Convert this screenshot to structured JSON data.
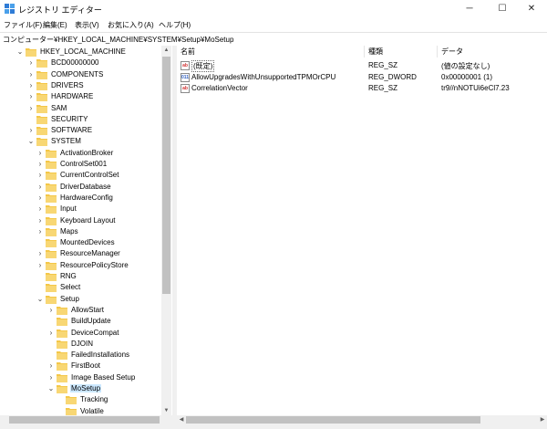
{
  "window": {
    "title": "レジストリ エディター",
    "controls": {
      "minimize": "─",
      "maximize": "☐",
      "close": "✕"
    }
  },
  "menu": [
    "ファイル(F)",
    "編集(E)",
    "表示(V)",
    "お気に入り(A)",
    "ヘルプ(H)"
  ],
  "address": "コンピューター¥HKEY_LOCAL_MACHINE¥SYSTEM¥Setup¥MoSetup",
  "tree": [
    {
      "label": "HKEY_LOCAL_MACHINE",
      "level": 0,
      "chevron": "v",
      "selected": false
    },
    {
      "label": "BCD00000000",
      "level": 1,
      "chevron": ">",
      "selected": false
    },
    {
      "label": "COMPONENTS",
      "level": 1,
      "chevron": ">",
      "selected": false
    },
    {
      "label": "DRIVERS",
      "level": 1,
      "chevron": ">",
      "selected": false
    },
    {
      "label": "HARDWARE",
      "level": 1,
      "chevron": ">",
      "selected": false
    },
    {
      "label": "SAM",
      "level": 1,
      "chevron": ">",
      "selected": false
    },
    {
      "label": "SECURITY",
      "level": 1,
      "chevron": "",
      "selected": false
    },
    {
      "label": "SOFTWARE",
      "level": 1,
      "chevron": ">",
      "selected": false
    },
    {
      "label": "SYSTEM",
      "level": 1,
      "chevron": "v",
      "selected": false
    },
    {
      "label": "ActivationBroker",
      "level": 2,
      "chevron": ">",
      "selected": false
    },
    {
      "label": "ControlSet001",
      "level": 2,
      "chevron": ">",
      "selected": false
    },
    {
      "label": "CurrentControlSet",
      "level": 2,
      "chevron": ">",
      "selected": false
    },
    {
      "label": "DriverDatabase",
      "level": 2,
      "chevron": ">",
      "selected": false
    },
    {
      "label": "HardwareConfig",
      "level": 2,
      "chevron": ">",
      "selected": false
    },
    {
      "label": "Input",
      "level": 2,
      "chevron": ">",
      "selected": false
    },
    {
      "label": "Keyboard Layout",
      "level": 2,
      "chevron": ">",
      "selected": false
    },
    {
      "label": "Maps",
      "level": 2,
      "chevron": ">",
      "selected": false
    },
    {
      "label": "MountedDevices",
      "level": 2,
      "chevron": "",
      "selected": false
    },
    {
      "label": "ResourceManager",
      "level": 2,
      "chevron": ">",
      "selected": false
    },
    {
      "label": "ResourcePolicyStore",
      "level": 2,
      "chevron": ">",
      "selected": false
    },
    {
      "label": "RNG",
      "level": 2,
      "chevron": "",
      "selected": false
    },
    {
      "label": "Select",
      "level": 2,
      "chevron": "",
      "selected": false
    },
    {
      "label": "Setup",
      "level": 2,
      "chevron": "v",
      "selected": false
    },
    {
      "label": "AllowStart",
      "level": 3,
      "chevron": ">",
      "selected": false
    },
    {
      "label": "BuildUpdate",
      "level": 3,
      "chevron": "",
      "selected": false
    },
    {
      "label": "DeviceCompat",
      "level": 3,
      "chevron": ">",
      "selected": false
    },
    {
      "label": "DJOIN",
      "level": 3,
      "chevron": "",
      "selected": false
    },
    {
      "label": "FailedInstallations",
      "level": 3,
      "chevron": "",
      "selected": false
    },
    {
      "label": "FirstBoot",
      "level": 3,
      "chevron": ">",
      "selected": false
    },
    {
      "label": "Image Based Setup",
      "level": 3,
      "chevron": ">",
      "selected": false
    },
    {
      "label": "MoSetup",
      "level": 3,
      "chevron": "v",
      "selected": true
    },
    {
      "label": "Tracking",
      "level": 4,
      "chevron": "",
      "selected": false
    },
    {
      "label": "Volatile",
      "level": 4,
      "chevron": "",
      "selected": false
    }
  ],
  "columns": {
    "name": "名前",
    "type": "種類",
    "data": "データ"
  },
  "values": [
    {
      "name": "(既定)",
      "type": "REG_SZ",
      "data": "(値の設定なし)",
      "icon": "string-value-icon",
      "default": true
    },
    {
      "name": "AllowUpgradesWithUnsupportedTPMOrCPU",
      "type": "REG_DWORD",
      "data": "0x00000001 (1)",
      "icon": "dword-value-icon",
      "default": false
    },
    {
      "name": "CorrelationVector",
      "type": "REG_SZ",
      "data": "tr9//nNOTUi6eCl7.23",
      "icon": "string-value-icon",
      "default": false
    }
  ],
  "colors": {
    "selection": "#cce8ff",
    "folder": "#f4c748",
    "value_string": "#d03030",
    "value_dword": "#3060c0"
  }
}
